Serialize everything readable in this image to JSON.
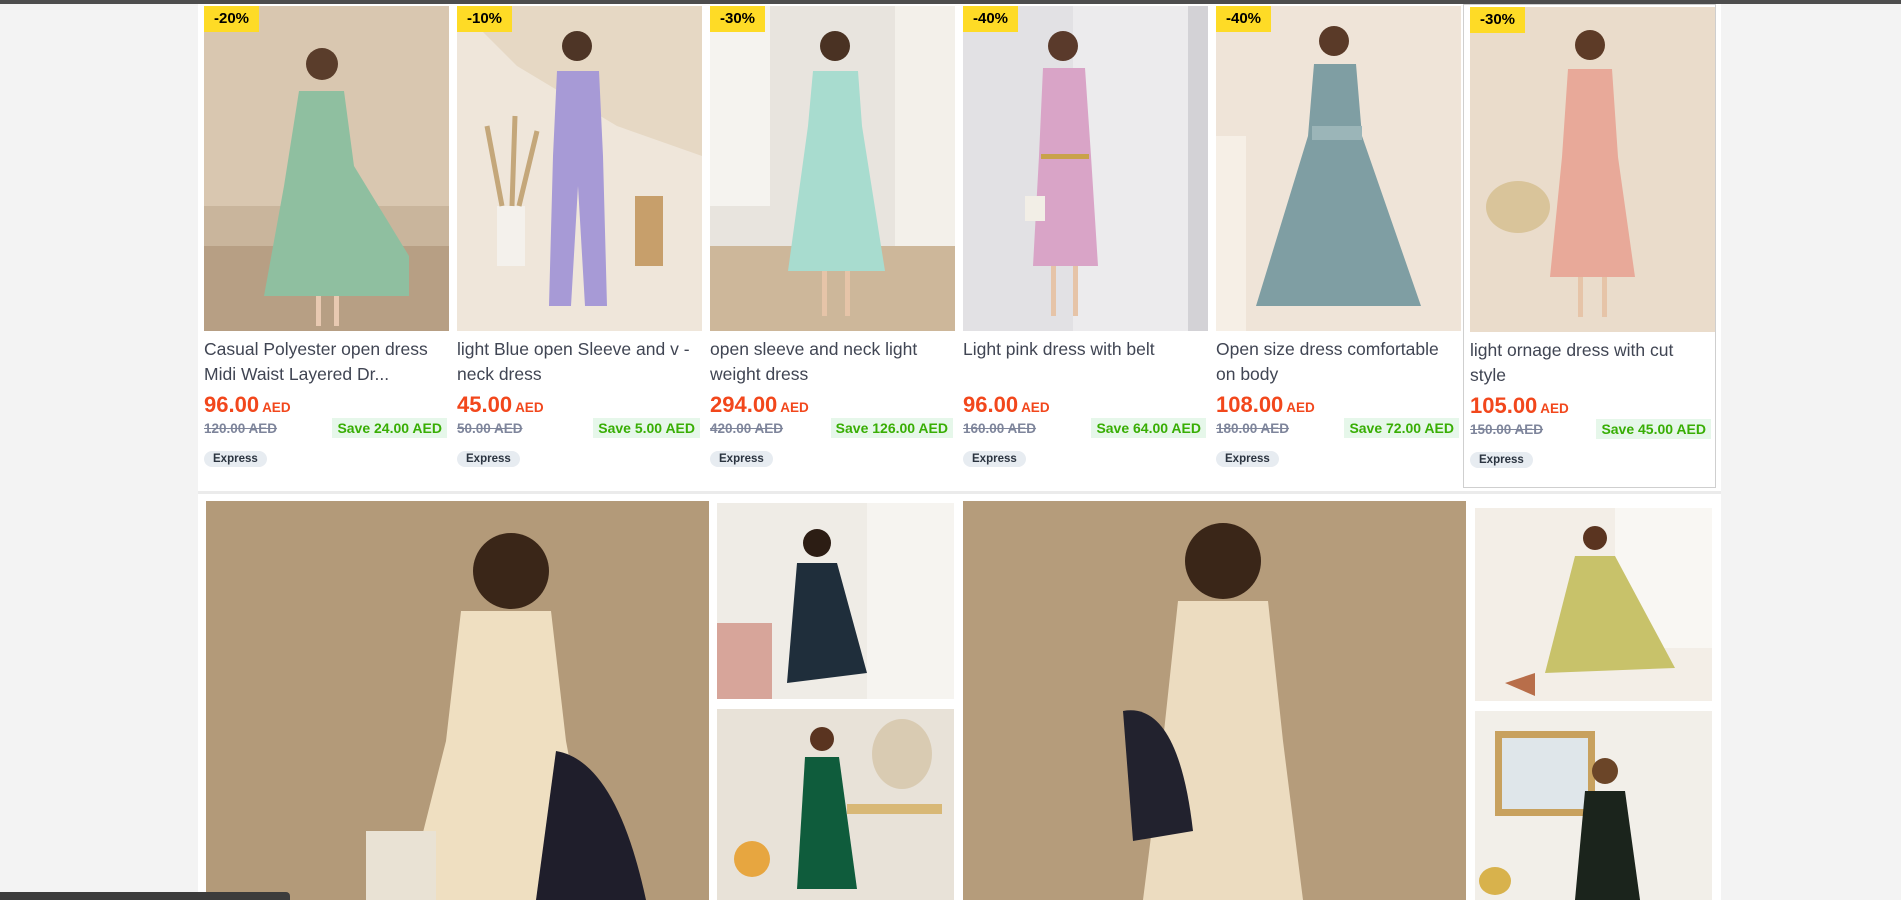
{
  "products": [
    {
      "discount": "-20%",
      "title": "Casual Polyester open dress Midi Waist Layered Dr...",
      "price": "96.00",
      "currency": "AED",
      "old_price": "120.00 AED",
      "save": "Save 24.00 AED",
      "tag": "Express"
    },
    {
      "discount": "-10%",
      "title": "light Blue open Sleeve and v - neck dress",
      "price": "45.00",
      "currency": "AED",
      "old_price": "50.00 AED",
      "save": "Save 5.00 AED",
      "tag": "Express"
    },
    {
      "discount": "-30%",
      "title": "open sleeve and neck light weight dress",
      "price": "294.00",
      "currency": "AED",
      "old_price": "420.00 AED",
      "save": "Save 126.00 AED",
      "tag": "Express"
    },
    {
      "discount": "-40%",
      "title": "Light pink dress with belt",
      "price": "96.00",
      "currency": "AED",
      "old_price": "160.00 AED",
      "save": "Save 64.00 AED",
      "tag": "Express"
    },
    {
      "discount": "-40%",
      "title": "Open size dress comfortable on body",
      "price": "108.00",
      "currency": "AED",
      "old_price": "180.00 AED",
      "save": "Save 72.00 AED",
      "tag": "Express"
    },
    {
      "discount": "-30%",
      "title": "light ornage dress with cut style",
      "price": "105.00",
      "currency": "AED",
      "old_price": "150.00 AED",
      "save": "Save 45.00 AED",
      "tag": "Express"
    }
  ],
  "colors": {
    "badge": "#fedb26",
    "price": "#f2471c",
    "save_text": "#38ae04",
    "save_bg": "#e6f7ea",
    "title": "#404553"
  }
}
